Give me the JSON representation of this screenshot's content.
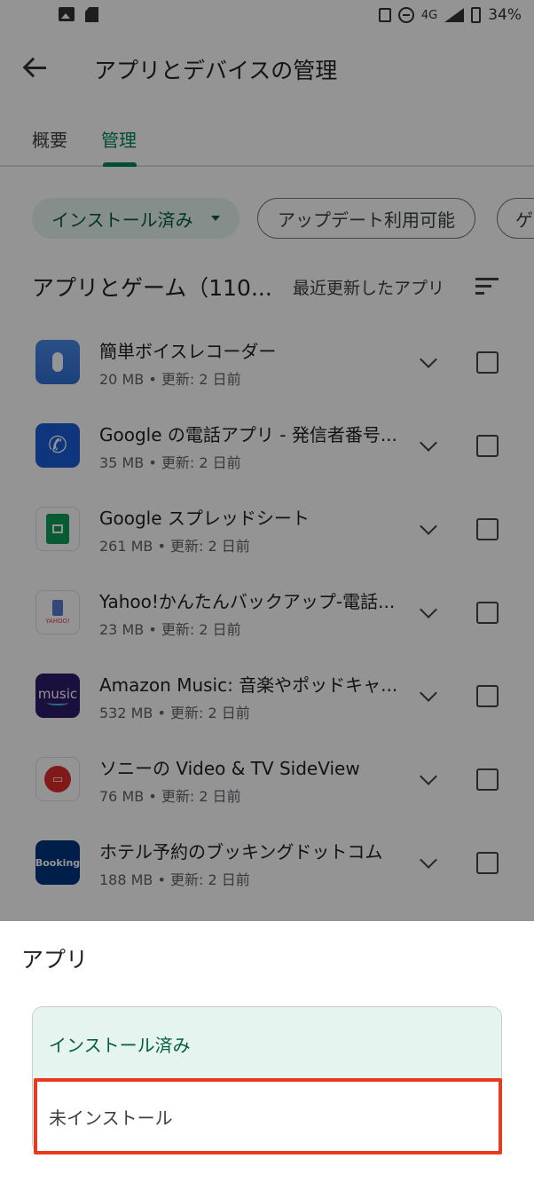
{
  "status_bar": {
    "network": "4G",
    "battery": "34%"
  },
  "app_bar": {
    "title": "アプリとデバイスの管理"
  },
  "tabs": [
    {
      "label": "概要"
    },
    {
      "label": "管理"
    }
  ],
  "chips": [
    {
      "label": "インストール済み"
    },
    {
      "label": "アップデート利用可能"
    },
    {
      "label": "ゲ"
    }
  ],
  "section": {
    "title": "アプリとゲーム（110...",
    "sort_label": "最近更新したアプリ"
  },
  "apps": [
    {
      "name": "簡単ボイスレコーダー",
      "meta": "20 MB • 更新: 2 日前"
    },
    {
      "name": "Google の電話アプリ - 発信者番号...",
      "meta": "35 MB • 更新: 2 日前"
    },
    {
      "name": "Google スプレッドシート",
      "meta": "261 MB • 更新: 2 日前"
    },
    {
      "name": "Yahoo!かんたんバックアップ-電話...",
      "meta": "23 MB • 更新: 2 日前",
      "icon_text": "YAHOO!"
    },
    {
      "name": "Amazon Music: 音楽やポッドキャ...",
      "meta": "532 MB • 更新: 2 日前",
      "icon_text": "music"
    },
    {
      "name": "ソニーの Video & TV SideView",
      "meta": "76 MB • 更新: 2 日前"
    },
    {
      "name": "ホテル予約のブッキングドットコム",
      "meta": "188 MB • 更新: 2 日前",
      "icon_text": "Booking"
    }
  ],
  "sheet": {
    "title": "アプリ",
    "options": [
      {
        "label": "インストール済み",
        "selected": true
      },
      {
        "label": "未インストール",
        "selected": false
      }
    ]
  },
  "colors": {
    "accent": "#01875f",
    "selected_bg": "#e6f4ef",
    "highlight": "#e83a1f"
  }
}
